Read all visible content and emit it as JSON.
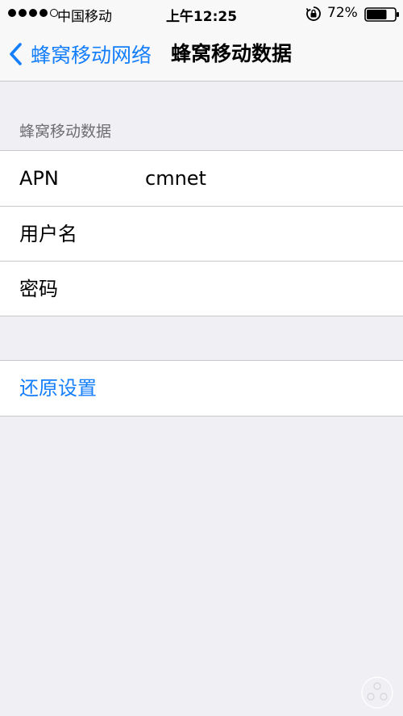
{
  "status_bar": {
    "signal_bars_filled": 4,
    "signal_bars_total": 5,
    "carrier": "中国移动",
    "time": "上午12:25",
    "orientation_lock_icon": "rotation-lock-icon",
    "battery_percent": "72%",
    "battery_level": 0.72
  },
  "nav": {
    "back_label": "蜂窝移动网络",
    "back_icon": "chevron-left-icon",
    "title": "蜂窝移动数据"
  },
  "section": {
    "header": "蜂窝移动数据",
    "rows": [
      {
        "label": "APN",
        "value": "cmnet"
      },
      {
        "label": "用户名",
        "value": ""
      },
      {
        "label": "密码",
        "value": ""
      }
    ]
  },
  "reset": {
    "label": "还原设置"
  },
  "colors": {
    "accent": "#147efb",
    "background": "#efeff4",
    "separator": "#c8c7cc"
  }
}
